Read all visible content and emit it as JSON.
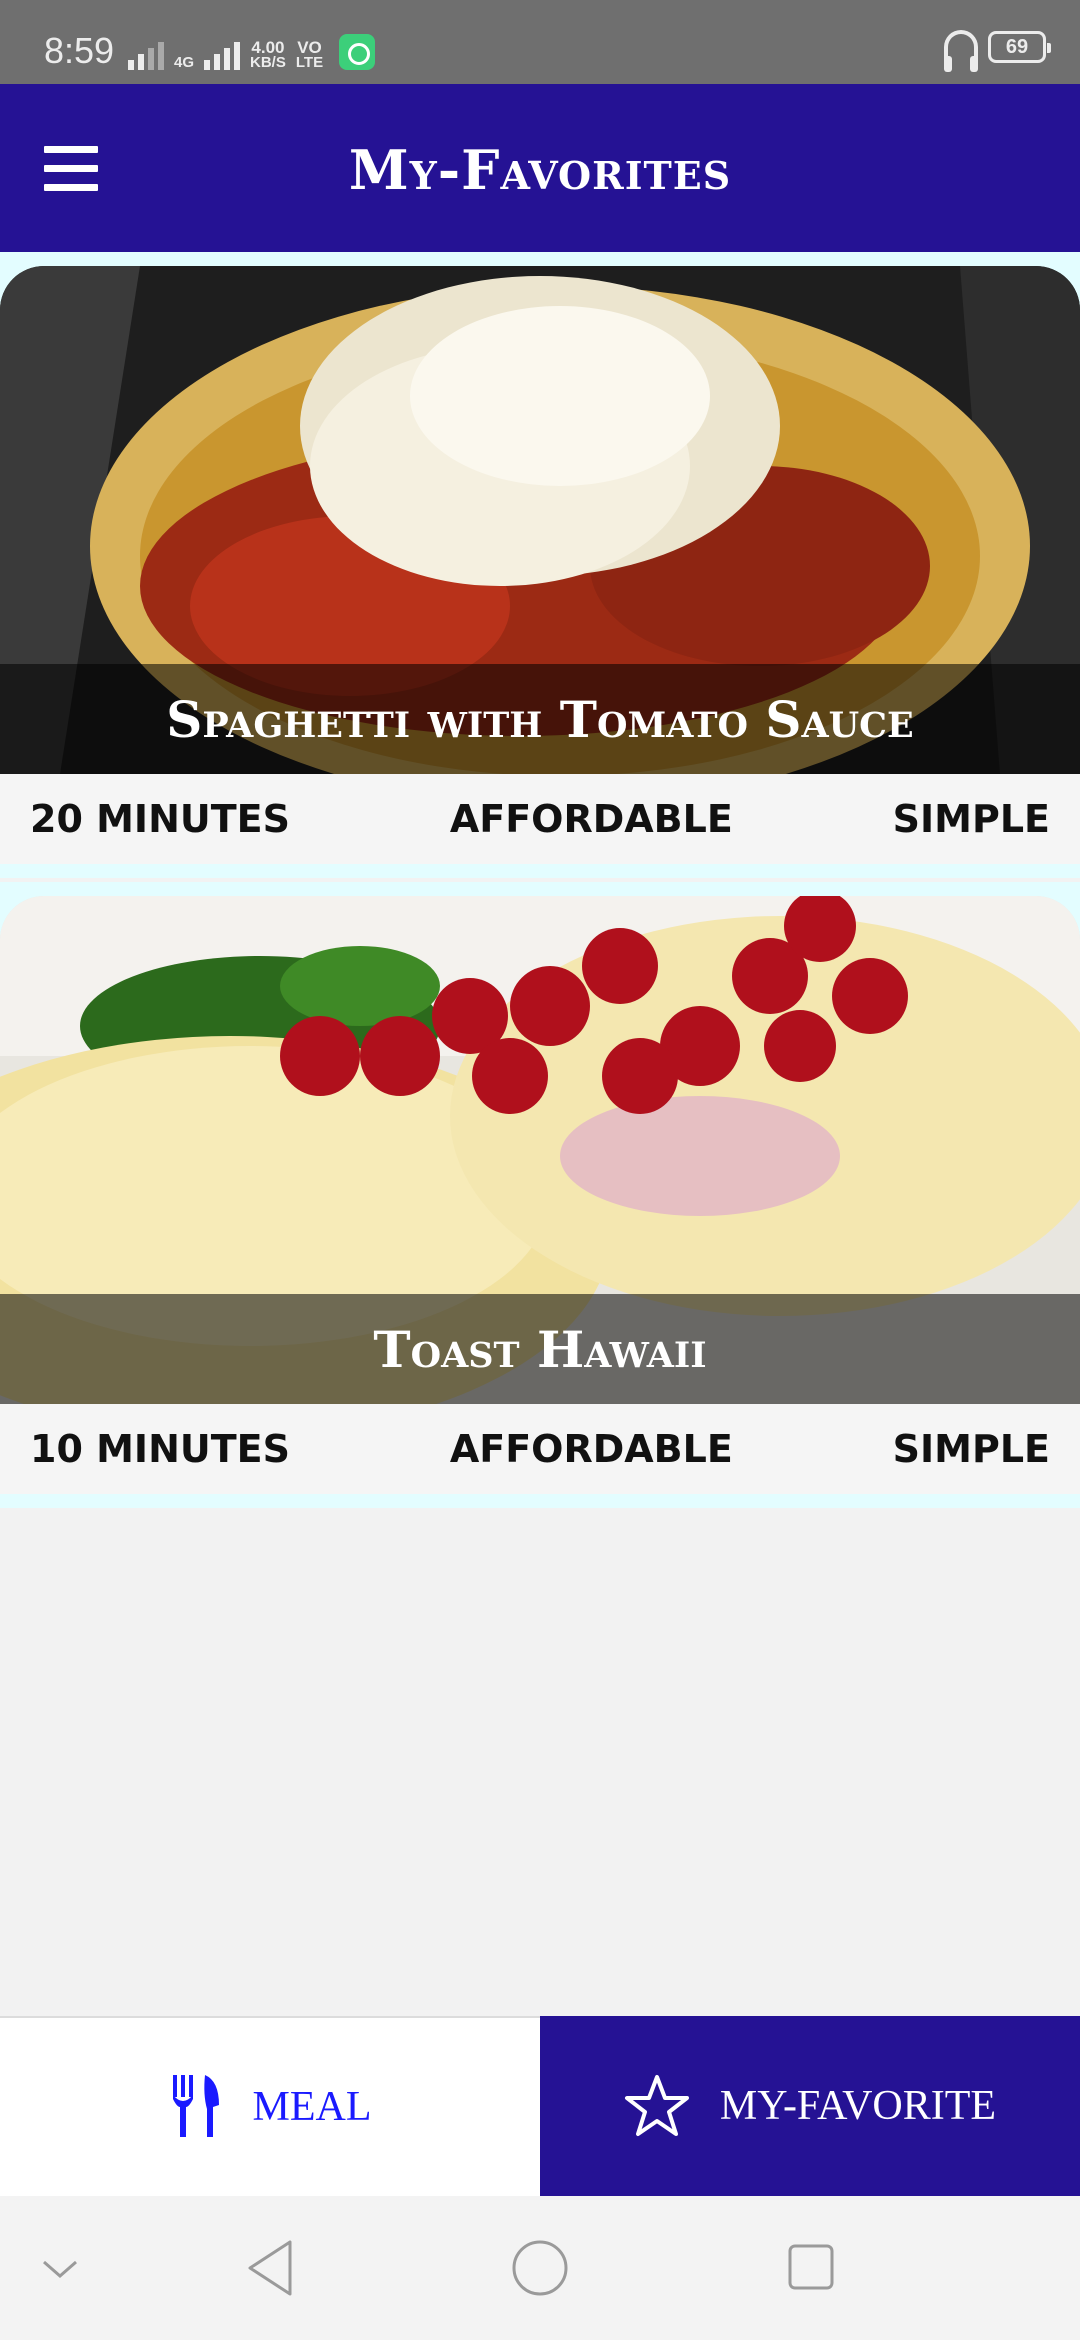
{
  "status_bar": {
    "time": "8:59",
    "network_speed": "4.00",
    "network_unit": "KB/S",
    "network_type": "4G",
    "volte_top": "VO",
    "volte_bottom": "LTE",
    "battery": "69"
  },
  "app_bar": {
    "title": "My-Favorites",
    "menu_icon": "hamburger-menu-icon"
  },
  "meals": [
    {
      "title": "Spaghetti with Tomato Sauce",
      "duration": "20 MINUTES",
      "affordability": "AFFORDABLE",
      "complexity": "SIMPLE"
    },
    {
      "title": "Toast Hawaii",
      "duration": "10 MINUTES",
      "affordability": "AFFORDABLE",
      "complexity": "SIMPLE"
    }
  ],
  "bottom_nav": {
    "tabs": [
      {
        "label": "MEAL",
        "icon": "cutlery-icon",
        "active": false
      },
      {
        "label": "MY-FAVORITE",
        "icon": "star-icon",
        "active": true
      }
    ]
  },
  "colors": {
    "primary": "#251294",
    "accent_text": "#1a1aff",
    "card_background": "#e3fdff"
  }
}
